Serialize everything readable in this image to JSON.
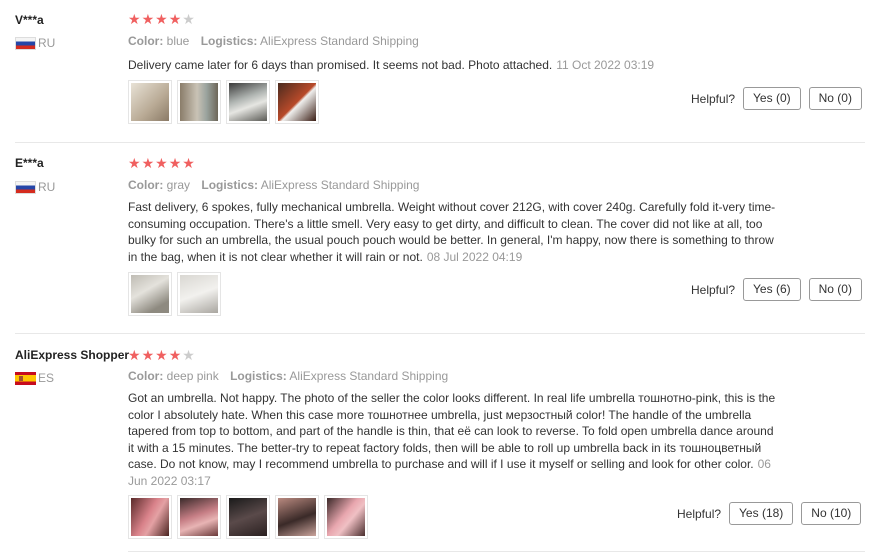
{
  "labels": {
    "color": "Color:",
    "logistics": "Logistics:",
    "helpful": "Helpful?"
  },
  "reviews": [
    {
      "name": "V***a",
      "country": "RU",
      "rating": 4,
      "color": "blue",
      "logistics": "AliExpress Standard Shipping",
      "text": "Delivery came later for 6 days than promised. It seems not bad. Photo attached.",
      "date": "11 Oct 2022 03:19",
      "yes": "Yes (0)",
      "no": "No (0)"
    },
    {
      "name": "E***a",
      "country": "RU",
      "rating": 5,
      "color": "gray",
      "logistics": "AliExpress Standard Shipping",
      "text": "Fast delivery, 6 spokes, fully mechanical umbrella. Weight without cover 212G, with cover 240g. Carefully fold it-very time-consuming occupation. There's a little smell. Very easy to get dirty, and difficult to clean. The cover did not like at all, too bulky for such an umbrella, the usual pouch pouch would be better. In general, I'm happy, now there is something to throw in the bag, when it is not clear whether it will rain or not.",
      "date": "08 Jul 2022 04:19",
      "yes": "Yes (6)",
      "no": "No (0)"
    },
    {
      "name": "AliExpress Shopper",
      "country": "ES",
      "rating": 4,
      "color": "deep pink",
      "logistics": "AliExpress Standard Shipping",
      "text": "Got an umbrella. Not happy. The photo of the seller the color looks different. In real life umbrella тошнотно-pink, this is the color I absolutely hate. When this case more тошнотнее umbrella, just мерзостный color! The handle of the umbrella tapered from top to bottom, and part of the handle is thin, that её can look to reverse. To fold open umbrella dance around it with a 15 minutes. The better-try to repeat factory folds, then will be able to roll up umbrella back in its тошноцветный case. Do not know, may I recommend umbrella to purchase and will if I use it myself or selling and look for other color.",
      "date": "06 Jun 2022 03:17",
      "yes": "Yes (18)",
      "no": "No (10)"
    }
  ],
  "colors": {
    "star_on": "#f06060",
    "star_off": "#cccccc",
    "muted_text": "#999999"
  }
}
